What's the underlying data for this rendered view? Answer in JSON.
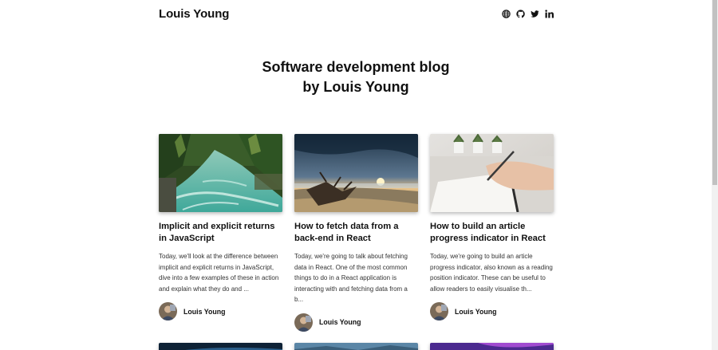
{
  "header": {
    "brand": "Louis Young",
    "icons": [
      "globe-icon",
      "github-icon",
      "twitter-icon",
      "linkedin-icon"
    ]
  },
  "hero": {
    "line1": "Software development blog",
    "line2": "by Louis Young"
  },
  "posts": [
    {
      "title": "Implicit and explicit returns in JavaScript",
      "excerpt": "Today, we'll look at the difference between implicit and explicit returns in JavaScript, dive into a few examples of these in action and explain what they do and ...",
      "author": "Louis Young",
      "image": "river-forest-image"
    },
    {
      "title": "How to fetch data from a back-end in React",
      "excerpt": "Today, we're going to talk about fetching data in React. One of the most common things to do in a React application is interacting with and fetching data from a b...",
      "author": "Louis Young",
      "image": "beach-sunset-image"
    },
    {
      "title": "How to build an article progress indicator in React",
      "excerpt": "Today, we're going to build an article progress indicator, also known as a reading position indicator. These can be useful to allow readers to easily visualise th...",
      "author": "Louis Young",
      "image": "writing-notebook-image"
    }
  ],
  "colors": {
    "background": "#ffffff",
    "text": "#111111",
    "excerpt": "#333333",
    "scrollbar_thumb": "#c1c1c1"
  }
}
